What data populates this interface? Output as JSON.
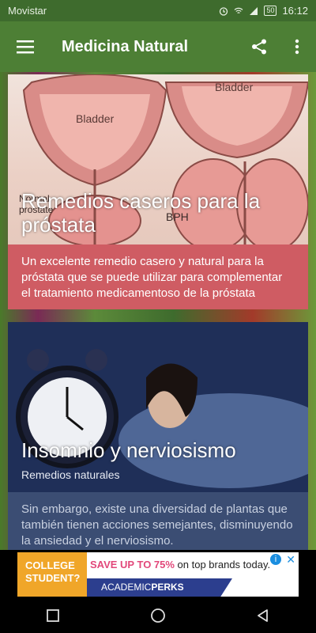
{
  "status_bar": {
    "carrier": "Movistar",
    "battery": "50",
    "time": "16:12"
  },
  "app_bar": {
    "title": "Medicina Natural"
  },
  "cards": [
    {
      "title": "Remedios caseros para la próstata",
      "description": "Un excelente remedio casero y natural para la próstata que se puede utilizar para complementar el tratamiento medicamentoso de la próstata",
      "image_labels": [
        "Bladder",
        "Bladder",
        "Normal prostate",
        "BPH"
      ]
    },
    {
      "title": "Insomnio y nerviosismo",
      "subtitle": "Remedios naturales",
      "description": "Sin embargo, existe una diversidad de plantas que también tienen acciones semejantes, disminuyendo la ansiedad y el nerviosismo."
    }
  ],
  "ad": {
    "left_text": "COLLEGE STUDENT?",
    "headline_highlight": "SAVE UP TO 75%",
    "headline_rest": " on top brands today.",
    "brand_a": "ACADEMIC",
    "brand_b": "PERKS"
  },
  "colors": {
    "status_bar": "#3e6b2d",
    "app_bar": "#4d7f35",
    "card1_text_bg": "#cf5c63",
    "card2_bg": "#3b4d73"
  }
}
